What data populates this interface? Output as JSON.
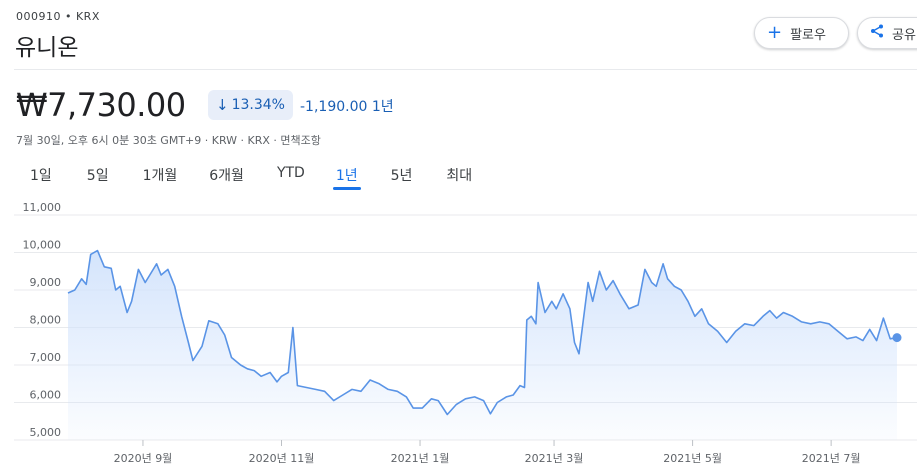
{
  "header": {
    "ticker": "000910 • KRX",
    "name": "유니온",
    "follow_label": "팔로우",
    "share_label": "공유"
  },
  "quote": {
    "price": "₩7,730.00",
    "change_pct": "13.34%",
    "change_abs": "-1,190.00 1년",
    "meta": "7월 30일, 오후 6시 0분 30초 GMT+9 · KRW · KRX · 면책조항"
  },
  "ranges": [
    {
      "label": "1일",
      "active": false
    },
    {
      "label": "5일",
      "active": false
    },
    {
      "label": "1개월",
      "active": false
    },
    {
      "label": "6개월",
      "active": false
    },
    {
      "label": "YTD",
      "active": false
    },
    {
      "label": "1년",
      "active": true
    },
    {
      "label": "5년",
      "active": false
    },
    {
      "label": "최대",
      "active": false
    }
  ],
  "colors": {
    "line": "#5a94e6",
    "fill": "#d2e3fc",
    "accent": "#1a73e8",
    "negative": "#1a5fb4"
  },
  "chart_data": {
    "type": "area",
    "ylim": [
      5000,
      11000
    ],
    "yticks": [
      11000,
      10000,
      9000,
      8000,
      7000,
      6000,
      5000
    ],
    "ytick_labels": [
      "11,000",
      "10,000",
      "9,000",
      "8,000",
      "7,000",
      "6,000",
      "5,000"
    ],
    "xtick_labels": [
      "2020년 9월",
      "2020년 11월",
      "2021년 1월",
      "2021년 3월",
      "2021년 5월",
      "2021년 7월"
    ],
    "xtick_dates": [
      "2020-09-01",
      "2020-11-01",
      "2021-01-01",
      "2021-03-01",
      "2021-05-01",
      "2021-07-01"
    ],
    "points": [
      [
        "2020-07-30",
        8920
      ],
      [
        "2020-08-02",
        9000
      ],
      [
        "2020-08-05",
        9300
      ],
      [
        "2020-08-07",
        9150
      ],
      [
        "2020-08-09",
        9950
      ],
      [
        "2020-08-12",
        10050
      ],
      [
        "2020-08-15",
        9620
      ],
      [
        "2020-08-18",
        9580
      ],
      [
        "2020-08-20",
        9000
      ],
      [
        "2020-08-22",
        9100
      ],
      [
        "2020-08-25",
        8400
      ],
      [
        "2020-08-27",
        8700
      ],
      [
        "2020-08-30",
        9550
      ],
      [
        "2020-09-02",
        9200
      ],
      [
        "2020-09-04",
        9400
      ],
      [
        "2020-09-07",
        9700
      ],
      [
        "2020-09-09",
        9400
      ],
      [
        "2020-09-12",
        9550
      ],
      [
        "2020-09-15",
        9100
      ],
      [
        "2020-09-18",
        8300
      ],
      [
        "2020-09-21",
        7600
      ],
      [
        "2020-09-23",
        7120
      ],
      [
        "2020-09-27",
        7500
      ],
      [
        "2020-09-30",
        8180
      ],
      [
        "2020-10-04",
        8100
      ],
      [
        "2020-10-07",
        7800
      ],
      [
        "2020-10-10",
        7200
      ],
      [
        "2020-10-14",
        7000
      ],
      [
        "2020-10-17",
        6900
      ],
      [
        "2020-10-20",
        6850
      ],
      [
        "2020-10-23",
        6700
      ],
      [
        "2020-10-27",
        6800
      ],
      [
        "2020-10-30",
        6550
      ],
      [
        "2020-11-01",
        6700
      ],
      [
        "2020-11-04",
        6800
      ],
      [
        "2020-11-06",
        8000
      ],
      [
        "2020-11-08",
        6450
      ],
      [
        "2020-11-12",
        6400
      ],
      [
        "2020-11-16",
        6350
      ],
      [
        "2020-11-20",
        6300
      ],
      [
        "2020-11-24",
        6050
      ],
      [
        "2020-11-28",
        6200
      ],
      [
        "2020-12-02",
        6350
      ],
      [
        "2020-12-06",
        6300
      ],
      [
        "2020-12-10",
        6600
      ],
      [
        "2020-12-14",
        6500
      ],
      [
        "2020-12-18",
        6350
      ],
      [
        "2020-12-22",
        6300
      ],
      [
        "2020-12-26",
        6150
      ],
      [
        "2020-12-29",
        5850
      ],
      [
        "2021-01-02",
        5850
      ],
      [
        "2021-01-06",
        6100
      ],
      [
        "2021-01-09",
        6050
      ],
      [
        "2021-01-13",
        5680
      ],
      [
        "2021-01-17",
        5950
      ],
      [
        "2021-01-21",
        6100
      ],
      [
        "2021-01-25",
        6150
      ],
      [
        "2021-01-29",
        6050
      ],
      [
        "2021-02-01",
        5700
      ],
      [
        "2021-02-04",
        6000
      ],
      [
        "2021-02-08",
        6150
      ],
      [
        "2021-02-11",
        6200
      ],
      [
        "2021-02-14",
        6450
      ],
      [
        "2021-02-16",
        6400
      ],
      [
        "2021-02-17",
        8200
      ],
      [
        "2021-02-19",
        8300
      ],
      [
        "2021-02-21",
        8100
      ],
      [
        "2021-02-22",
        9200
      ],
      [
        "2021-02-25",
        8400
      ],
      [
        "2021-02-28",
        8700
      ],
      [
        "2021-03-02",
        8500
      ],
      [
        "2021-03-05",
        8900
      ],
      [
        "2021-03-08",
        8500
      ],
      [
        "2021-03-10",
        7600
      ],
      [
        "2021-03-12",
        7300
      ],
      [
        "2021-03-16",
        9200
      ],
      [
        "2021-03-18",
        8700
      ],
      [
        "2021-03-21",
        9500
      ],
      [
        "2021-03-24",
        9000
      ],
      [
        "2021-03-27",
        9250
      ],
      [
        "2021-03-30",
        8900
      ],
      [
        "2021-04-03",
        8500
      ],
      [
        "2021-04-07",
        8600
      ],
      [
        "2021-04-10",
        9550
      ],
      [
        "2021-04-13",
        9200
      ],
      [
        "2021-04-15",
        9100
      ],
      [
        "2021-04-18",
        9700
      ],
      [
        "2021-04-20",
        9300
      ],
      [
        "2021-04-23",
        9100
      ],
      [
        "2021-04-26",
        9000
      ],
      [
        "2021-04-29",
        8700
      ],
      [
        "2021-05-02",
        8300
      ],
      [
        "2021-05-05",
        8500
      ],
      [
        "2021-05-08",
        8100
      ],
      [
        "2021-05-12",
        7900
      ],
      [
        "2021-05-16",
        7600
      ],
      [
        "2021-05-20",
        7900
      ],
      [
        "2021-05-24",
        8100
      ],
      [
        "2021-05-28",
        8050
      ],
      [
        "2021-06-01",
        8300
      ],
      [
        "2021-06-04",
        8450
      ],
      [
        "2021-06-07",
        8250
      ],
      [
        "2021-06-10",
        8400
      ],
      [
        "2021-06-14",
        8300
      ],
      [
        "2021-06-18",
        8150
      ],
      [
        "2021-06-22",
        8100
      ],
      [
        "2021-06-26",
        8150
      ],
      [
        "2021-06-30",
        8100
      ],
      [
        "2021-07-04",
        7900
      ],
      [
        "2021-07-08",
        7700
      ],
      [
        "2021-07-12",
        7750
      ],
      [
        "2021-07-15",
        7650
      ],
      [
        "2021-07-18",
        7950
      ],
      [
        "2021-07-21",
        7650
      ],
      [
        "2021-07-24",
        8250
      ],
      [
        "2021-07-27",
        7700
      ],
      [
        "2021-07-30",
        7730
      ]
    ]
  }
}
